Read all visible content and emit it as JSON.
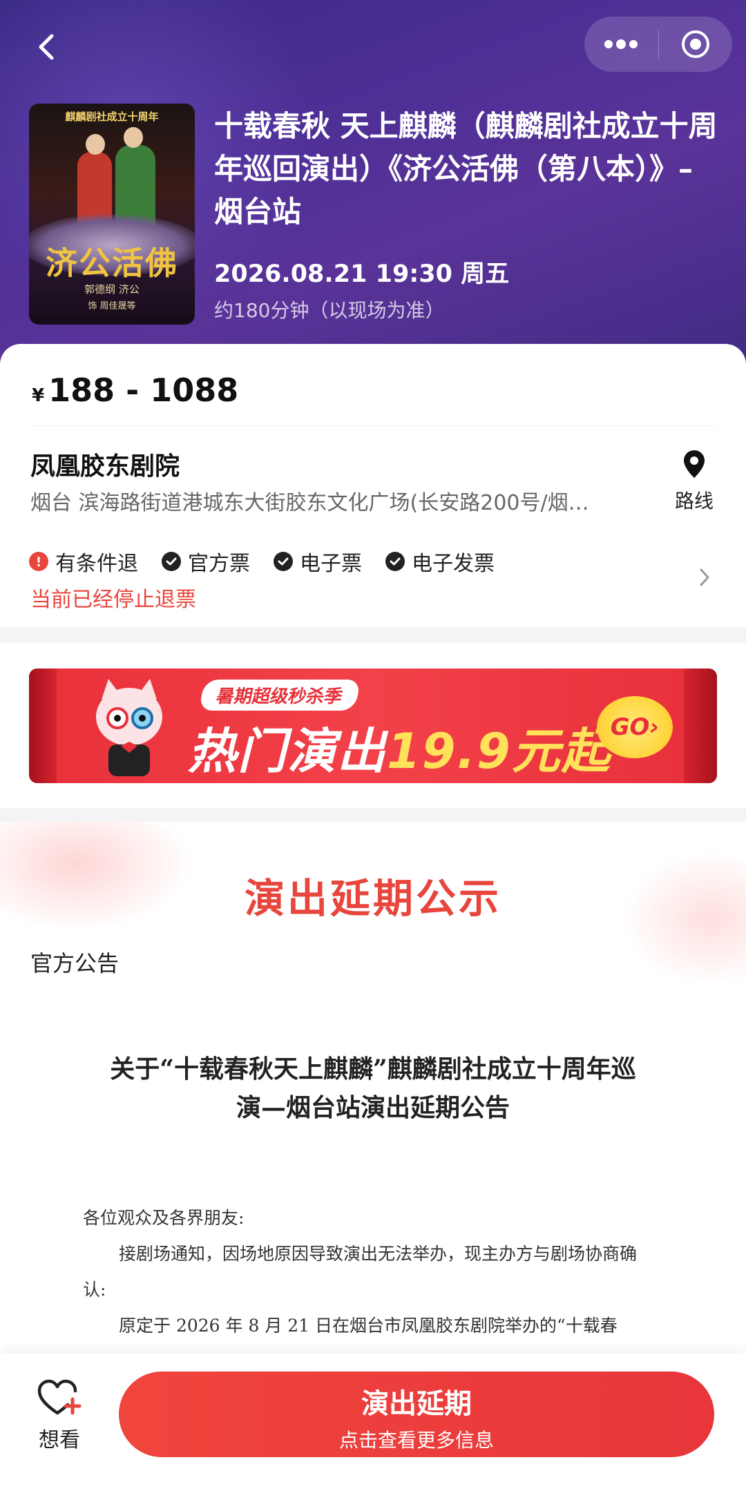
{
  "header": {
    "back_icon": "back-arrow-icon",
    "menu_icon": "more-dots-icon",
    "close_icon": "target-circle-icon"
  },
  "poster": {
    "top_text": "麒麟剧社成立十周年",
    "main_text": "济公活佛",
    "sub_text": "郭德纲 济公",
    "sub_text2": "饰 周佳晟等"
  },
  "show": {
    "title": "十载春秋 天上麒麟（麒麟剧社成立十周年巡回演出）《济公活佛（第八本）》–烟台站",
    "datetime": "2026.08.21 19:30 周五",
    "duration": "约180分钟（以现场为准）"
  },
  "price": {
    "currency": "¥",
    "range": "188 - 1088"
  },
  "venue": {
    "name": "凤凰胶东剧院",
    "address": "烟台 滨海路街道港城东大街胶东文化广场(长安路200号/烟…",
    "route_label": "路线"
  },
  "tags": [
    {
      "label": "有条件退",
      "icon": "alert-circle-icon",
      "color": "#e8453c"
    },
    {
      "label": "官方票",
      "icon": "check-circle-icon",
      "color": "#222222"
    },
    {
      "label": "电子票",
      "icon": "check-circle-icon",
      "color": "#222222"
    },
    {
      "label": "电子发票",
      "icon": "check-circle-icon",
      "color": "#222222"
    }
  ],
  "refund_note": "当前已经停止退票",
  "banner": {
    "tagline": "暑期超级秒杀季",
    "promo_prefix": "热门演出",
    "promo_highlight": "19.9元起",
    "go_label": "GO›"
  },
  "notice": {
    "title": "演出延期公示",
    "label": "官方公告",
    "doc_title_line1": "关于“十载春秋天上麒麟”麒麟剧社成立十周年巡",
    "doc_title_line2": "演—烟台站演出延期公告",
    "greeting": "各位观众及各界朋友:",
    "para1": "接剧场通知，因场地原因导致演出无法举办，现主办方与剧场协商确认:",
    "para2": "原定于 2026 年 8 月 21 日在烟台市凤凰胶东剧院举办的“十载春"
  },
  "bottom": {
    "fav_label": "想看",
    "cta_main": "演出延期",
    "cta_sub": "点击查看更多信息"
  },
  "colors": {
    "accent_red": "#e8453c",
    "header_purple": "#4d2f96"
  }
}
